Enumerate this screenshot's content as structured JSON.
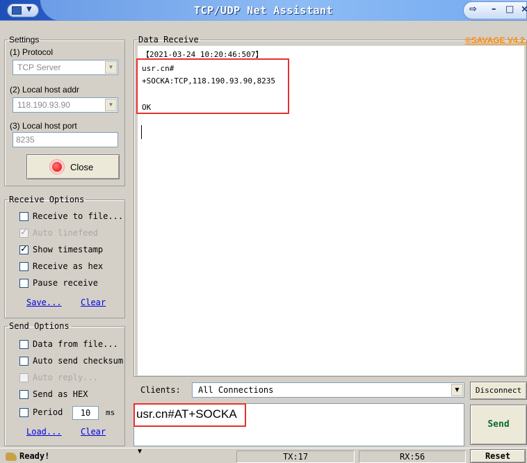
{
  "window": {
    "title": "TCP/UDP Net Assistant",
    "controls": "← - □ ×"
  },
  "settings": {
    "legend": "Settings",
    "protocol_label": "(1) Protocol",
    "protocol_value": "TCP Server",
    "host_label": "(2) Local host addr",
    "host_value": "118.190.93.90",
    "port_label": "(3) Local host port",
    "port_value": "8235",
    "close_label": "Close"
  },
  "receive_options": {
    "legend": "Receive Options",
    "items": [
      {
        "label": "Receive to file...",
        "checked": false,
        "enabled": true
      },
      {
        "label": "Auto linefeed",
        "checked": true,
        "enabled": false
      },
      {
        "label": "Show timestamp",
        "checked": true,
        "enabled": true
      },
      {
        "label": "Receive as hex",
        "checked": false,
        "enabled": true
      },
      {
        "label": "Pause receive",
        "checked": false,
        "enabled": true
      }
    ],
    "save_link": "Save...",
    "clear_link": "Clear"
  },
  "send_options": {
    "legend": "Send Options",
    "items": [
      {
        "label": "Data from file...",
        "checked": false,
        "enabled": true
      },
      {
        "label": "Auto send checksum",
        "checked": false,
        "enabled": true
      },
      {
        "label": "Auto reply...",
        "checked": false,
        "enabled": false
      },
      {
        "label": "Send as HEX",
        "checked": false,
        "enabled": true
      },
      {
        "label": "Period",
        "checked": false,
        "enabled": true
      }
    ],
    "period_value": "10",
    "period_unit": "ms",
    "load_link": "Load...",
    "clear_link": "Clear"
  },
  "data_receive": {
    "legend": "Data Receive",
    "brand": "®SAVAGE V4.2.",
    "lines": [
      "【2021-03-24 10:20:46:507】",
      "usr.cn#",
      "+SOCKA:TCP,118.190.93.90,8235",
      "",
      "OK"
    ]
  },
  "clients": {
    "label": "Clients:",
    "value": "All Connections",
    "disconnect": "Disconnect"
  },
  "send": {
    "text": "usr.cn#AT+SOCKA",
    "button": "Send"
  },
  "status": {
    "ready": "Ready!",
    "tx": "TX:17",
    "rx": "RX:56",
    "reset": "Reset"
  },
  "colors": {
    "highlight_box": "#e8302a",
    "brand": "#ff8a00",
    "send_button_text": "#0b6b2f"
  }
}
